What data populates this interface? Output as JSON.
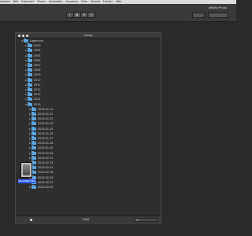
{
  "menubar": {
    "items": [
      "arbeiten",
      "Bild",
      "Dokument",
      "Ebene",
      "Auswahlen",
      "Anordnen",
      "Filter",
      "Ansicht",
      "Fenster",
      "Hilfe"
    ]
  },
  "toolbar": {
    "app_title": "Affinity Photo"
  },
  "panel": {
    "title": "Media",
    "tree": [
      {
        "label": "Lightroom",
        "depth": 0,
        "expanded": true
      },
      {
        "label": "2003",
        "depth": 1,
        "expanded": false
      },
      {
        "label": "2004",
        "depth": 1,
        "expanded": false
      },
      {
        "label": "2005",
        "depth": 1,
        "expanded": false
      },
      {
        "label": "2006",
        "depth": 1,
        "expanded": false
      },
      {
        "label": "2007",
        "depth": 1,
        "expanded": false
      },
      {
        "label": "2008",
        "depth": 1,
        "expanded": false
      },
      {
        "label": "2009",
        "depth": 1,
        "expanded": false
      },
      {
        "label": "2010",
        "depth": 1,
        "expanded": false
      },
      {
        "label": "2011",
        "depth": 1,
        "expanded": false
      },
      {
        "label": "2012",
        "depth": 1,
        "expanded": false
      },
      {
        "label": "2013",
        "depth": 1,
        "expanded": false
      },
      {
        "label": "2014",
        "depth": 1,
        "expanded": false
      },
      {
        "label": "2015",
        "depth": 1,
        "expanded": true
      },
      {
        "label": "2015-01-11",
        "depth": 2,
        "expanded": false
      },
      {
        "label": "2015-01-21",
        "depth": 2,
        "expanded": false
      },
      {
        "label": "2015-01-22",
        "depth": 2,
        "expanded": false
      },
      {
        "label": "2015-01-23",
        "depth": 2,
        "expanded": false
      },
      {
        "label": "2015-01-24",
        "depth": 2,
        "expanded": false
      },
      {
        "label": "2015-01-25",
        "depth": 2,
        "expanded": false
      },
      {
        "label": "2015-01-27",
        "depth": 2,
        "expanded": false
      },
      {
        "label": "2015-01-28",
        "depth": 2,
        "expanded": false
      },
      {
        "label": "2015-01-30",
        "depth": 2,
        "expanded": false
      },
      {
        "label": "2015-02-09",
        "depth": 2,
        "expanded": false
      },
      {
        "label": "2015-02-11",
        "depth": 2,
        "expanded": false
      },
      {
        "label": "2015-02-13",
        "depth": 2,
        "expanded": false
      },
      {
        "label": "2015-02-14",
        "depth": 2,
        "expanded": false
      },
      {
        "label": "2015-02-15",
        "depth": 2,
        "expanded": false
      },
      {
        "label": "2015-02-20",
        "depth": 2,
        "expanded": false
      },
      {
        "label": "2015-02-21",
        "depth": 2,
        "expanded": false
      },
      {
        "label": "2015-02-26",
        "depth": 2,
        "expanded": false
      }
    ],
    "thumbnail": {
      "caption": "DSC03948.NEF"
    },
    "footer": {
      "count": "1 Bild",
      "search_placeholder": ""
    }
  },
  "colors": {
    "folder": "#5aa6e0",
    "selected_caption": "#2f5bff"
  }
}
